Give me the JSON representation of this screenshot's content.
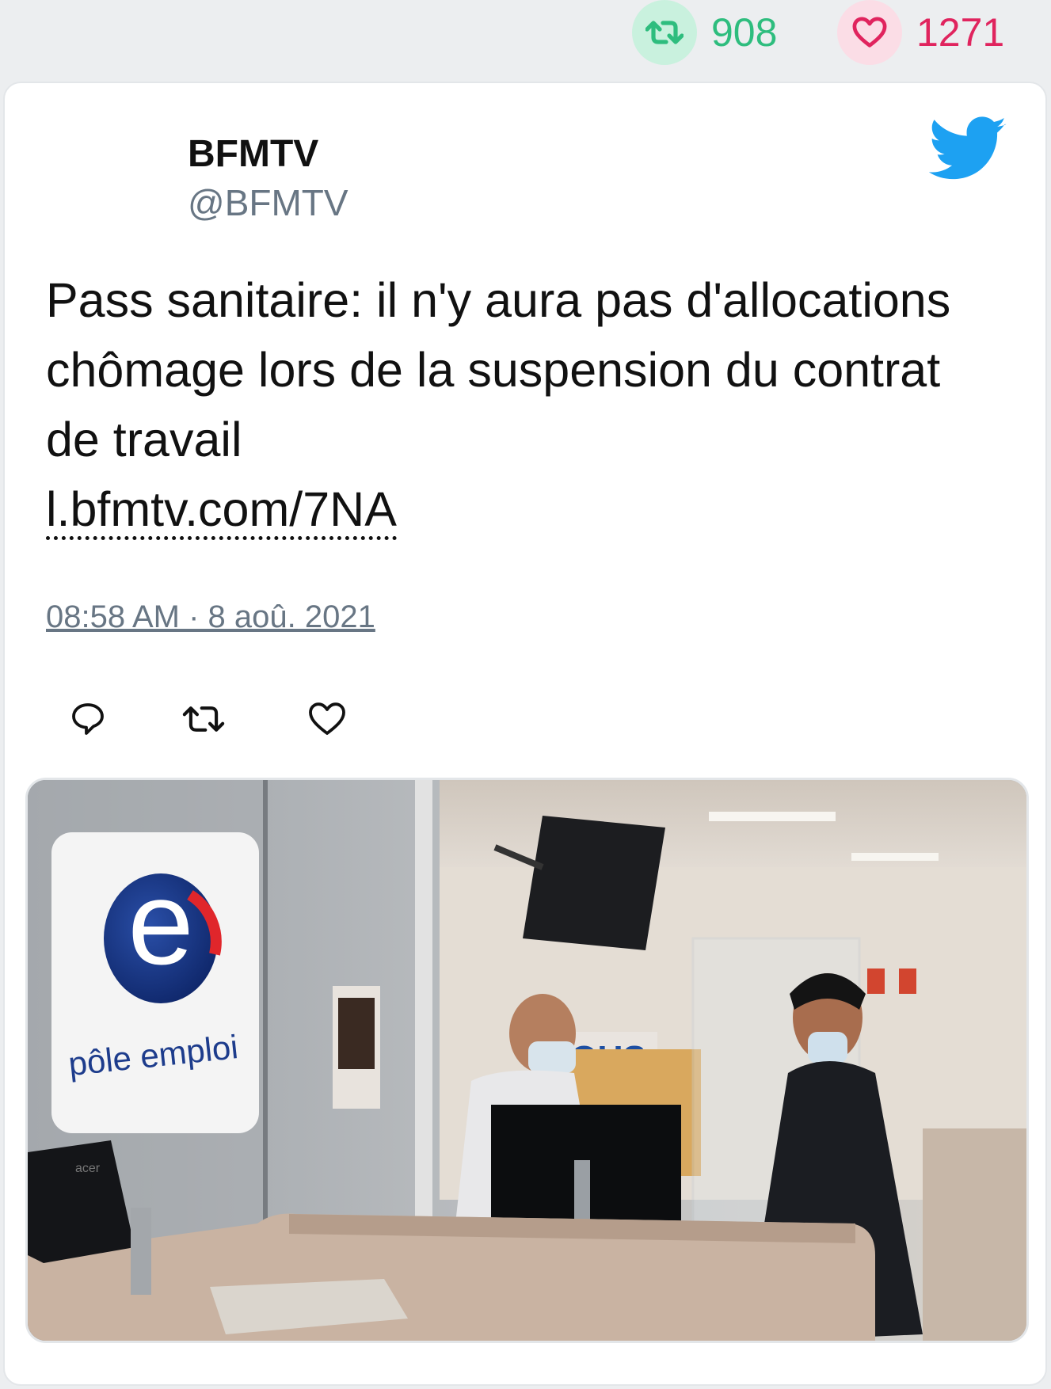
{
  "stats": {
    "retweet_count": "908",
    "like_count": "1271",
    "colors": {
      "retweet": "#2ebd7e",
      "like": "#e0245e"
    }
  },
  "tweet": {
    "author_name": "BFMTV",
    "author_handle": "@BFMTV",
    "text": "Pass sanitaire: il n'y aura pas d'allocations chômage lors de la suspension du contrat de travail",
    "link": "l.bfmtv.com/7NA",
    "timestamp": "08:58 AM · 8 aoû. 2021"
  },
  "actions": {
    "icons": [
      "reply-icon",
      "retweet-icon",
      "like-icon"
    ]
  },
  "media": {
    "logo_text": "pôle emploi",
    "logo_letter": "e",
    "sign_text": "TOUS",
    "monitor_brand": "acer"
  },
  "brand": {
    "icon": "twitter-bird-icon",
    "color": "#1da1f2"
  }
}
